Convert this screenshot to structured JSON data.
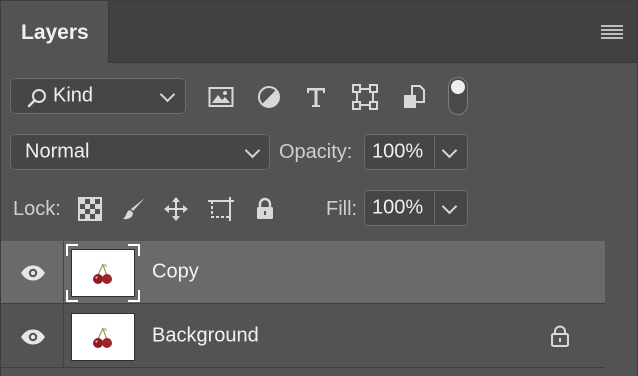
{
  "panel": {
    "tab_label": "Layers",
    "menu_icon": "hamburger-menu-icon"
  },
  "filter": {
    "kind_label": "Kind",
    "kind_icon": "search-icon",
    "icons": [
      "image-filter-icon",
      "adjustment-filter-icon",
      "type-filter-icon",
      "shape-filter-icon",
      "smart-object-filter-icon"
    ],
    "toggle_on": true
  },
  "blend": {
    "mode": "Normal",
    "opacity_label": "Opacity:",
    "opacity_value": "100%"
  },
  "lock": {
    "label": "Lock:",
    "icons": [
      "lock-transparent-pixels-icon",
      "lock-image-pixels-icon",
      "lock-position-icon",
      "lock-artboard-icon",
      "lock-all-icon"
    ],
    "fill_label": "Fill:",
    "fill_value": "100%"
  },
  "layers": [
    {
      "name": "Copy",
      "visible": true,
      "selected": true,
      "locked": false,
      "thumb_icon": "cherries-icon"
    },
    {
      "name": "Background",
      "visible": true,
      "selected": false,
      "locked": true,
      "thumb_icon": "cherries-icon"
    }
  ],
  "colors": {
    "panel_bg": "#535353",
    "selected_row": "#6a6a6a",
    "tab_bar": "#414141"
  }
}
